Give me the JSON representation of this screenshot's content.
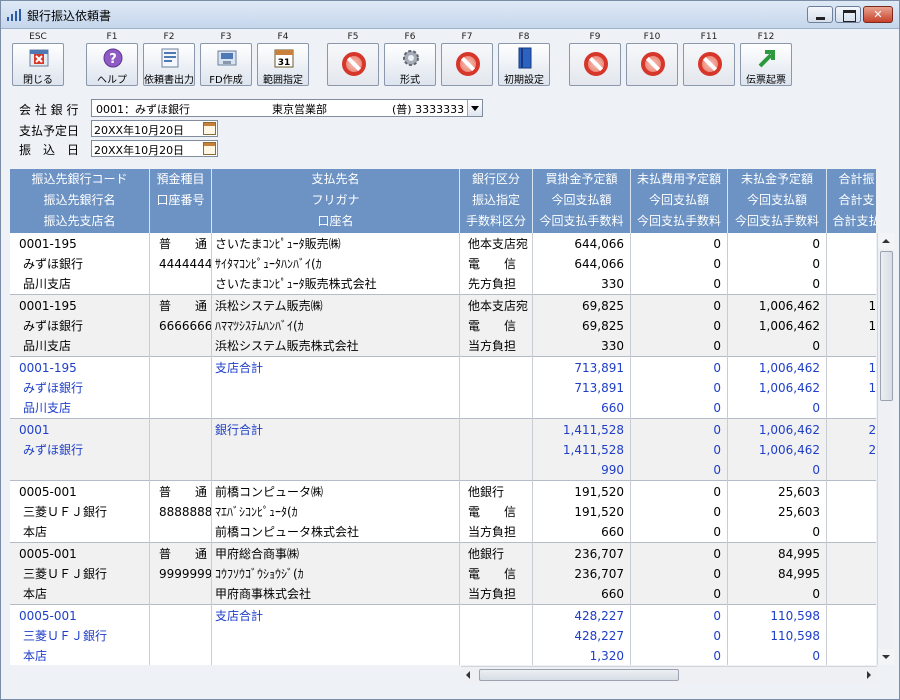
{
  "window": {
    "title": "銀行振込依頼書"
  },
  "toolbar": {
    "buttons": [
      {
        "key": "ESC",
        "label": "閉じる",
        "icon": "close-doc-icon"
      },
      {
        "key": "F1",
        "label": "ヘルプ",
        "icon": "help-icon"
      },
      {
        "key": "F2",
        "label": "依頼書出力",
        "icon": "print-doc-icon"
      },
      {
        "key": "F3",
        "label": "FD作成",
        "icon": "fd-create-icon"
      },
      {
        "key": "F4",
        "label": "範囲指定",
        "icon": "calendar-icon"
      },
      {
        "key": "F5",
        "label": "",
        "icon": "disabled-icon"
      },
      {
        "key": "F6",
        "label": "形式",
        "icon": "gear-icon"
      },
      {
        "key": "F7",
        "label": "",
        "icon": "disabled-icon"
      },
      {
        "key": "F8",
        "label": "初期設定",
        "icon": "book-icon"
      },
      {
        "key": "F9",
        "label": "",
        "icon": "disabled-icon"
      },
      {
        "key": "F10",
        "label": "",
        "icon": "disabled-icon"
      },
      {
        "key": "F11",
        "label": "",
        "icon": "disabled-icon"
      },
      {
        "key": "F12",
        "label": "伝票起票",
        "icon": "arrow-up-right-icon"
      }
    ]
  },
  "form": {
    "bank_label": "会 社 銀 行",
    "bank_code": "0001：みずほ銀行",
    "bank_branch": "東京営業部",
    "bank_account": "(普) 3333333",
    "pay_date_label": "支払予定日",
    "pay_date": "20XX年10月20日",
    "transfer_date_label": "振　込　日",
    "transfer_date": "20XX年10月20日"
  },
  "grid": {
    "headers": [
      [
        "振込先銀行コード",
        "振込先銀行名",
        "振込先支店名"
      ],
      [
        "預金種目",
        "口座番号",
        ""
      ],
      [
        "支払先名",
        "フリガナ",
        "口座名"
      ],
      [
        "銀行区分",
        "振込指定",
        "手数料区分"
      ],
      [
        "買掛金予定額",
        "今回支払額",
        "今回支払手数料"
      ],
      [
        "未払費用予定額",
        "今回支払額",
        "今回支払手数料"
      ],
      [
        "未払金予定額",
        "今回支払額",
        "今回支払手数料"
      ],
      [
        "合計振",
        "合計支",
        "合計支払"
      ]
    ],
    "rows": [
      {
        "kind": "detail",
        "code": [
          "0001-195",
          "みずほ銀行",
          "品川支店"
        ],
        "type": [
          "普　　通",
          "4444444",
          ""
        ],
        "payee": [
          "さいたまｺﾝﾋﾟｭｰﾀ販売㈱",
          "ｻｲﾀﾏｺﾝﾋﾟｭｰﾀﾊﾝﾊﾞｲ(ｶ",
          "さいたまｺﾝﾋﾟｭｰﾀ販売株式会社"
        ],
        "div": [
          "他本支店宛",
          "電　　信",
          "先方負担"
        ],
        "ap": [
          "644,066",
          "644,066",
          "330"
        ],
        "accr": [
          "0",
          "0",
          "0"
        ],
        "other": [
          "0",
          "0",
          "0"
        ],
        "total": [
          "",
          "",
          ""
        ]
      },
      {
        "kind": "detail",
        "code": [
          "0001-195",
          "みずほ銀行",
          "品川支店"
        ],
        "type": [
          "普　　通",
          "6666666",
          ""
        ],
        "payee": [
          "浜松システム販売㈱",
          "ﾊﾏﾏﾂｼｽﾃﾑﾊﾝﾊﾞｲ(ｶ",
          "浜松システム販売株式会社"
        ],
        "div": [
          "他本支店宛",
          "電　　信",
          "当方負担"
        ],
        "ap": [
          "69,825",
          "69,825",
          "330"
        ],
        "accr": [
          "0",
          "0",
          "0"
        ],
        "other": [
          "1,006,462",
          "1,006,462",
          "0"
        ],
        "total": [
          "1,",
          "1,",
          ""
        ]
      },
      {
        "kind": "subtotal",
        "code": [
          "0001-195",
          "みずほ銀行",
          "品川支店"
        ],
        "type": [
          "",
          "",
          ""
        ],
        "payee": [
          "支店合計",
          "",
          ""
        ],
        "div": [
          "",
          "",
          ""
        ],
        "ap": [
          "713,891",
          "713,891",
          "660"
        ],
        "accr": [
          "0",
          "0",
          "0"
        ],
        "other": [
          "1,006,462",
          "1,006,462",
          "0"
        ],
        "total": [
          "1,",
          "1,",
          ""
        ]
      },
      {
        "kind": "subtotal",
        "code": [
          "0001",
          "みずほ銀行",
          ""
        ],
        "type": [
          "",
          "",
          ""
        ],
        "payee": [
          "銀行合計",
          "",
          ""
        ],
        "div": [
          "",
          "",
          ""
        ],
        "ap": [
          "1,411,528",
          "1,411,528",
          "990"
        ],
        "accr": [
          "0",
          "0",
          "0"
        ],
        "other": [
          "1,006,462",
          "1,006,462",
          "0"
        ],
        "total": [
          "2,",
          "2,",
          ""
        ]
      },
      {
        "kind": "detail",
        "code": [
          "0005-001",
          "三菱ＵＦＪ銀行",
          "本店"
        ],
        "type": [
          "普　　通",
          "8888888",
          ""
        ],
        "payee": [
          "前橋コンピュータ㈱",
          "ﾏｴﾊﾞｼｺﾝﾋﾟｭｰﾀ(ｶ",
          "前橋コンピュータ株式会社"
        ],
        "div": [
          "他銀行",
          "電　　信",
          "当方負担"
        ],
        "ap": [
          "191,520",
          "191,520",
          "660"
        ],
        "accr": [
          "0",
          "0",
          "0"
        ],
        "other": [
          "25,603",
          "25,603",
          "0"
        ],
        "total": [
          "",
          "",
          ""
        ]
      },
      {
        "kind": "detail",
        "code": [
          "0005-001",
          "三菱ＵＦＪ銀行",
          "本店"
        ],
        "type": [
          "普　　通",
          "9999999",
          ""
        ],
        "payee": [
          "甲府総合商事㈱",
          "ｺｳﾌｿｳｺﾞｳｼｮｳｼﾞ(ｶ",
          "甲府商事株式会社"
        ],
        "div": [
          "他銀行",
          "電　　信",
          "当方負担"
        ],
        "ap": [
          "236,707",
          "236,707",
          "660"
        ],
        "accr": [
          "0",
          "0",
          "0"
        ],
        "other": [
          "84,995",
          "84,995",
          "0"
        ],
        "total": [
          "",
          "",
          ""
        ]
      },
      {
        "kind": "subtotal",
        "code": [
          "0005-001",
          "三菱ＵＦＪ銀行",
          "本店"
        ],
        "type": [
          "",
          "",
          ""
        ],
        "payee": [
          "支店合計",
          "",
          ""
        ],
        "div": [
          "",
          "",
          ""
        ],
        "ap": [
          "428,227",
          "428,227",
          "1,320"
        ],
        "accr": [
          "0",
          "0",
          "0"
        ],
        "other": [
          "110,598",
          "110,598",
          "0"
        ],
        "total": [
          "",
          "",
          ""
        ]
      }
    ]
  },
  "colors": {
    "header_bg": "#6c93c4",
    "subtotal_text": "#1e3ec8",
    "alt_row_bg": "#f1f1f1"
  }
}
